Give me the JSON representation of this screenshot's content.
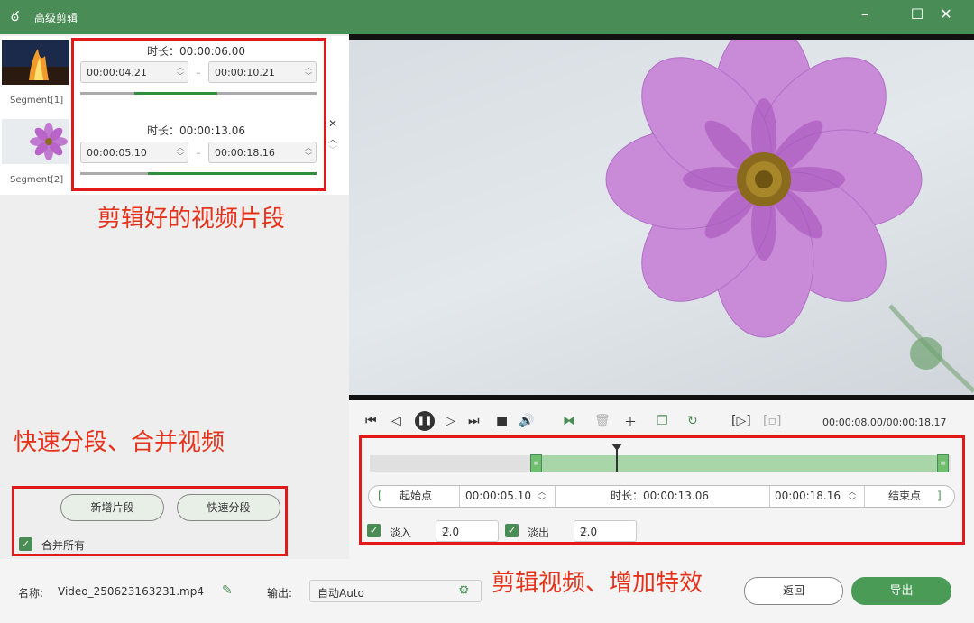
{
  "window": {
    "title": "高级剪辑"
  },
  "segments": [
    {
      "label": "Segment[1]",
      "duration_label": "时长：",
      "duration": "00:00:06.00",
      "start": "00:00:04.21",
      "end": "00:00:10.21",
      "progress": 0.58
    },
    {
      "label": "Segment[2]",
      "duration_label": "时长：",
      "duration": "00:00:13.06",
      "start": "00:00:05.10",
      "end": "00:00:18.16",
      "progress": 1.0
    }
  ],
  "annotations": {
    "clips": "剪辑好的视频片段",
    "split_merge": "快速分段、合并视频",
    "edit": "剪辑视频、增加特效"
  },
  "left_actions": {
    "add_segment": "新增片段",
    "quick_split": "快速分段",
    "merge_all": "合并所有"
  },
  "player": {
    "timecode": "00:00:08.00/00:00:18.17",
    "playhead_fraction": 0.39
  },
  "range": {
    "start_btn": "起始点",
    "start_time": "00:00:05.10",
    "duration_label": "时长：",
    "duration": "00:00:13.06",
    "end_time": "00:00:18.16",
    "end_btn": "结束点",
    "selection_start_fraction": 0.285,
    "selection_end_fraction": 0.99
  },
  "effects": {
    "fade_in_label": "淡入",
    "fade_in_value": "2.0",
    "fade_out_label": "淡出",
    "fade_out_value": "2.0"
  },
  "footer": {
    "name_label": "名称:",
    "filename": "Video_250623163231.mp4",
    "output_label": "输出:",
    "output_value": "自动Auto",
    "back": "返回",
    "export": "导出"
  },
  "colors": {
    "accent": "#4a8c55",
    "annotation": "#e0191b"
  }
}
